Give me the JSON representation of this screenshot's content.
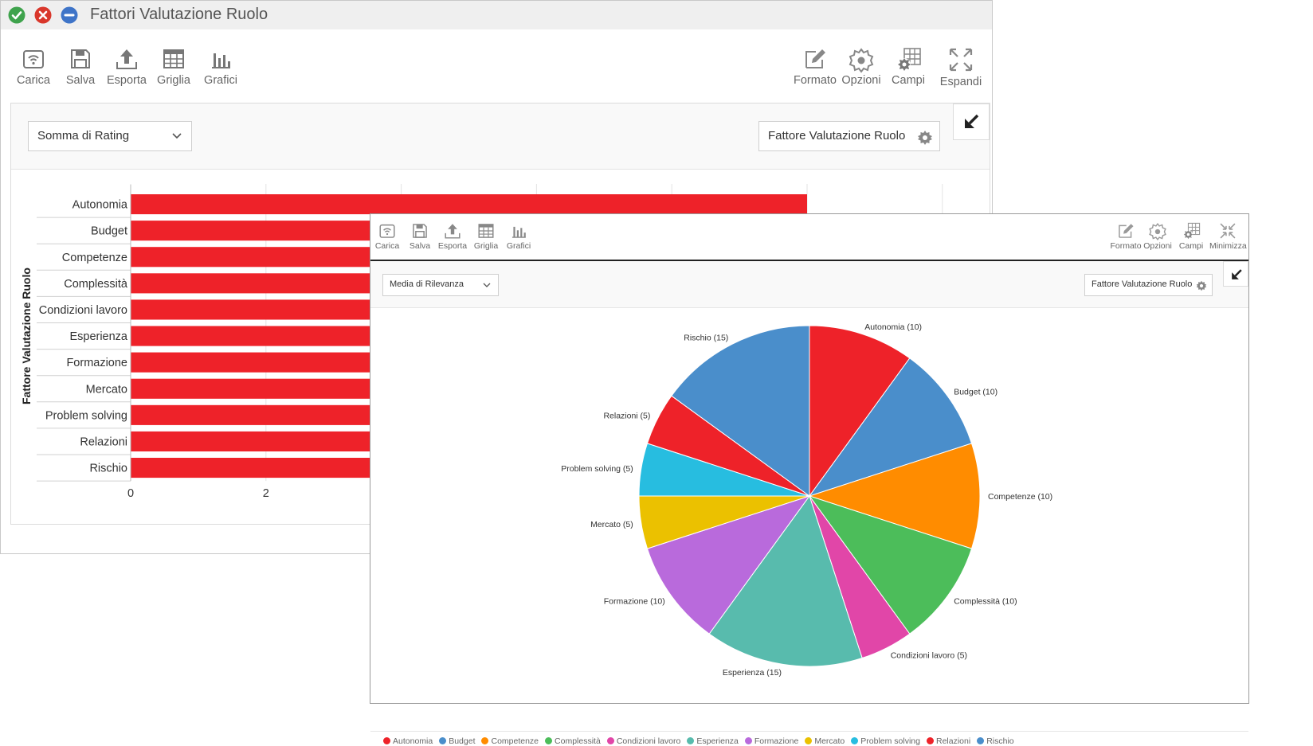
{
  "window1": {
    "title": "Fattori Valutazione Ruolo",
    "toolbar_left": [
      "Carica",
      "Salva",
      "Esporta",
      "Griglia",
      "Grafici"
    ],
    "toolbar_right": [
      "Formato",
      "Opzioni",
      "Campi",
      "Espandi"
    ],
    "measure_select": "Somma di Rating",
    "field_button": "Fattore Valutazione Ruolo"
  },
  "window2": {
    "toolbar_left": [
      "Carica",
      "Salva",
      "Esporta",
      "Griglia",
      "Grafici"
    ],
    "toolbar_right": [
      "Formato",
      "Opzioni",
      "Campi",
      "Minimizza"
    ],
    "measure_select": "Media di Rilevanza",
    "field_button": "Fattore Valutazione Ruolo"
  },
  "icons": {
    "confirm": "check-icon",
    "close": "close-icon",
    "minimize": "minus-icon",
    "collapse": "arrow-down-left-icon",
    "settings": "gear-icon",
    "dropdown": "chevron-down-icon"
  },
  "colors": {
    "bar": "#ee2229",
    "confirm": "#3fa34d",
    "close": "#d9372b",
    "minimize": "#3e74c8"
  },
  "chart_data": [
    {
      "type": "bar",
      "orientation": "horizontal",
      "ylabel": "Fattore Valutazione Ruolo",
      "categories": [
        "Autonomia",
        "Budget",
        "Competenze",
        "Complessità",
        "Condizioni lavoro",
        "Esperienza",
        "Formazione",
        "Mercato",
        "Problem solving",
        "Relazioni",
        "Rischio"
      ],
      "values": [
        10,
        null,
        null,
        null,
        null,
        null,
        null,
        null,
        null,
        null,
        null
      ],
      "x_ticks_visible": [
        "0",
        "2"
      ],
      "xlim": [
        0,
        12
      ],
      "grid": true
    },
    {
      "type": "pie",
      "categories": [
        "Autonomia",
        "Budget",
        "Competenze",
        "Complessità",
        "Condizioni lavoro",
        "Esperienza",
        "Formazione",
        "Mercato",
        "Problem solving",
        "Relazioni",
        "Rischio"
      ],
      "values": [
        10,
        10,
        10,
        10,
        5,
        15,
        10,
        5,
        5,
        5,
        15
      ],
      "labels": [
        "Autonomia (10)",
        "Budget (10)",
        "Competenze (10)",
        "Complessità (10)",
        "Condizioni lavoro (5)",
        "Esperienza (15)",
        "Formazione (10)",
        "Mercato (5)",
        "Problem solving (5)",
        "Relazioni (5)",
        "Rischio (15)"
      ],
      "colors": [
        "#ee2229",
        "#4a8ecb",
        "#ff8c00",
        "#4cbd5a",
        "#e146a8",
        "#58bbad",
        "#b96adc",
        "#ebc100",
        "#27bde0",
        "#ee2229",
        "#4a8ecb"
      ],
      "legend_position": "bottom"
    }
  ]
}
